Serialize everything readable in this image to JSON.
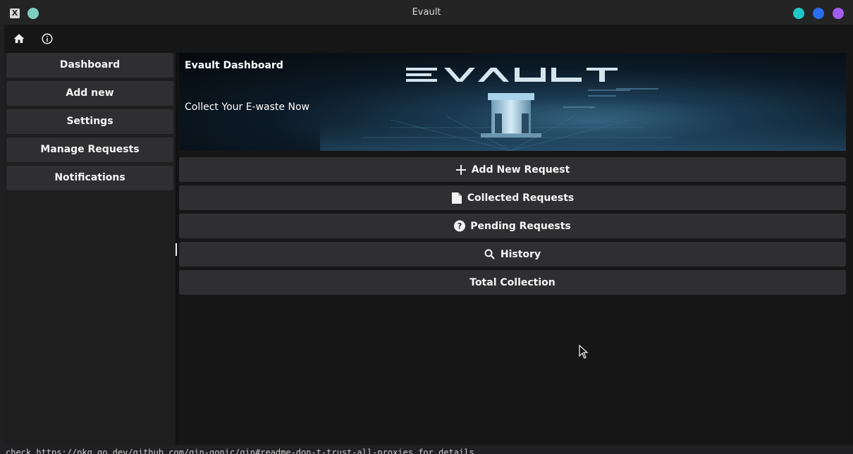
{
  "window": {
    "title": "Evault",
    "accent_dots": [
      "#1fc8c8",
      "#2a6ef0",
      "#a45cf0"
    ],
    "app_dot": "#7ecfc0"
  },
  "toolbar": {
    "home_icon": "home-icon",
    "info_icon": "info-icon"
  },
  "sidebar": {
    "items": [
      {
        "label": "Dashboard"
      },
      {
        "label": "Add new"
      },
      {
        "label": "Settings"
      },
      {
        "label": "Manage Requests"
      },
      {
        "label": "Notifications"
      }
    ]
  },
  "banner": {
    "title": "Evault Dashboard",
    "subtitle": "Collect Your E-waste Now",
    "logo_text": "EVAULT"
  },
  "actions": [
    {
      "label": "Add New Request",
      "icon": "plus-icon"
    },
    {
      "label": "Collected Requests",
      "icon": "document-icon"
    },
    {
      "label": "Pending Requests",
      "icon": "question-circle-icon"
    },
    {
      "label": "History",
      "icon": "search-icon"
    },
    {
      "label": "Total Collection",
      "icon": ""
    }
  ],
  "background_terminal": {
    "text": "check https://pkg.go.dev/github.com/gin-gonic/gin#readme-don-t-trust-all-proxies for details."
  }
}
